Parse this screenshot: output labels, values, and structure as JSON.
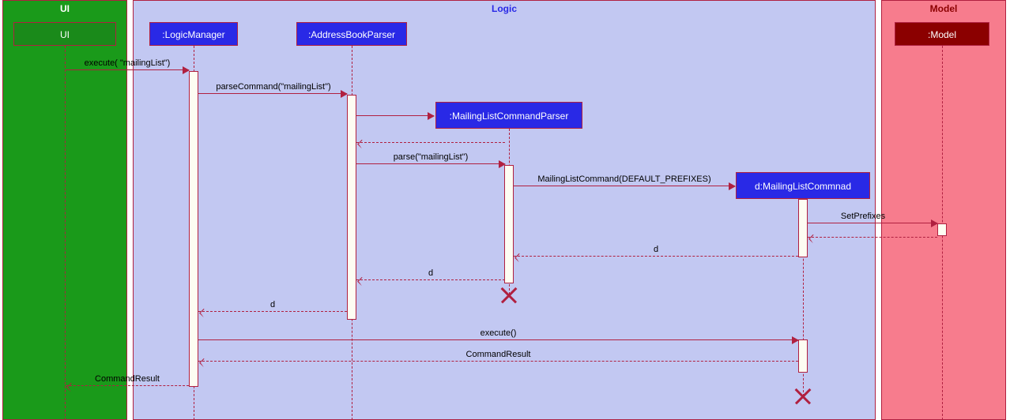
{
  "lanes": {
    "ui": "UI",
    "logic": "Logic",
    "model": "Model"
  },
  "heads": {
    "ui": "UI",
    "logicManager": ":LogicManager",
    "addressBookParser": ":AddressBookParser",
    "mlcParser": ":MailingListCommandParser",
    "mlc": "d:MailingListCommnad",
    "model": ":Model"
  },
  "messages": {
    "m1": "execute( \"mailingList\")",
    "m2": "parseCommand(\"mailingList\")",
    "m4": "parse(\"mailingList\")",
    "m5": "MailingListCommand(DEFAULT_PREFIXES)",
    "m6": "SetPrefixes",
    "m7": "d",
    "m8": "d",
    "m9": "d",
    "m10": "execute()",
    "m11": "CommandResult",
    "m12": "CommandResult"
  },
  "chart_data": {
    "type": "sequence_diagram",
    "lanes": [
      {
        "name": "UI",
        "participants": [
          "UI"
        ]
      },
      {
        "name": "Logic",
        "participants": [
          ":LogicManager",
          ":AddressBookParser",
          ":MailingListCommandParser",
          "d:MailingListCommnad"
        ]
      },
      {
        "name": "Model",
        "participants": [
          ":Model"
        ]
      }
    ],
    "messages": [
      {
        "from": "UI",
        "to": ":LogicManager",
        "label": "execute( \"mailingList\")",
        "type": "sync"
      },
      {
        "from": ":LogicManager",
        "to": ":AddressBookParser",
        "label": "parseCommand(\"mailingList\")",
        "type": "sync"
      },
      {
        "from": ":AddressBookParser",
        "to": ":MailingListCommandParser",
        "label": "",
        "type": "create"
      },
      {
        "from": ":MailingListCommandParser",
        "to": ":AddressBookParser",
        "label": "",
        "type": "return"
      },
      {
        "from": ":AddressBookParser",
        "to": ":MailingListCommandParser",
        "label": "parse(\"mailingList\")",
        "type": "sync"
      },
      {
        "from": ":MailingListCommandParser",
        "to": "d:MailingListCommnad",
        "label": "MailingListCommand(DEFAULT_PREFIXES)",
        "type": "create"
      },
      {
        "from": "d:MailingListCommnad",
        "to": ":Model",
        "label": "SetPrefixes",
        "type": "sync"
      },
      {
        "from": ":Model",
        "to": "d:MailingListCommnad",
        "label": "",
        "type": "return"
      },
      {
        "from": "d:MailingListCommnad",
        "to": ":MailingListCommandParser",
        "label": "d",
        "type": "return"
      },
      {
        "from": ":MailingListCommandParser",
        "to": ":AddressBookParser",
        "label": "d",
        "type": "return"
      },
      {
        "from": ":MailingListCommandParser",
        "to": ":MailingListCommandParser",
        "label": "",
        "type": "destroy"
      },
      {
        "from": ":AddressBookParser",
        "to": ":LogicManager",
        "label": "d",
        "type": "return"
      },
      {
        "from": ":LogicManager",
        "to": "d:MailingListCommnad",
        "label": "execute()",
        "type": "sync"
      },
      {
        "from": "d:MailingListCommnad",
        "to": ":LogicManager",
        "label": "CommandResult",
        "type": "return"
      },
      {
        "from": "d:MailingListCommnad",
        "to": "d:MailingListCommnad",
        "label": "",
        "type": "destroy"
      },
      {
        "from": ":LogicManager",
        "to": "UI",
        "label": "CommandResult",
        "type": "return"
      }
    ]
  }
}
